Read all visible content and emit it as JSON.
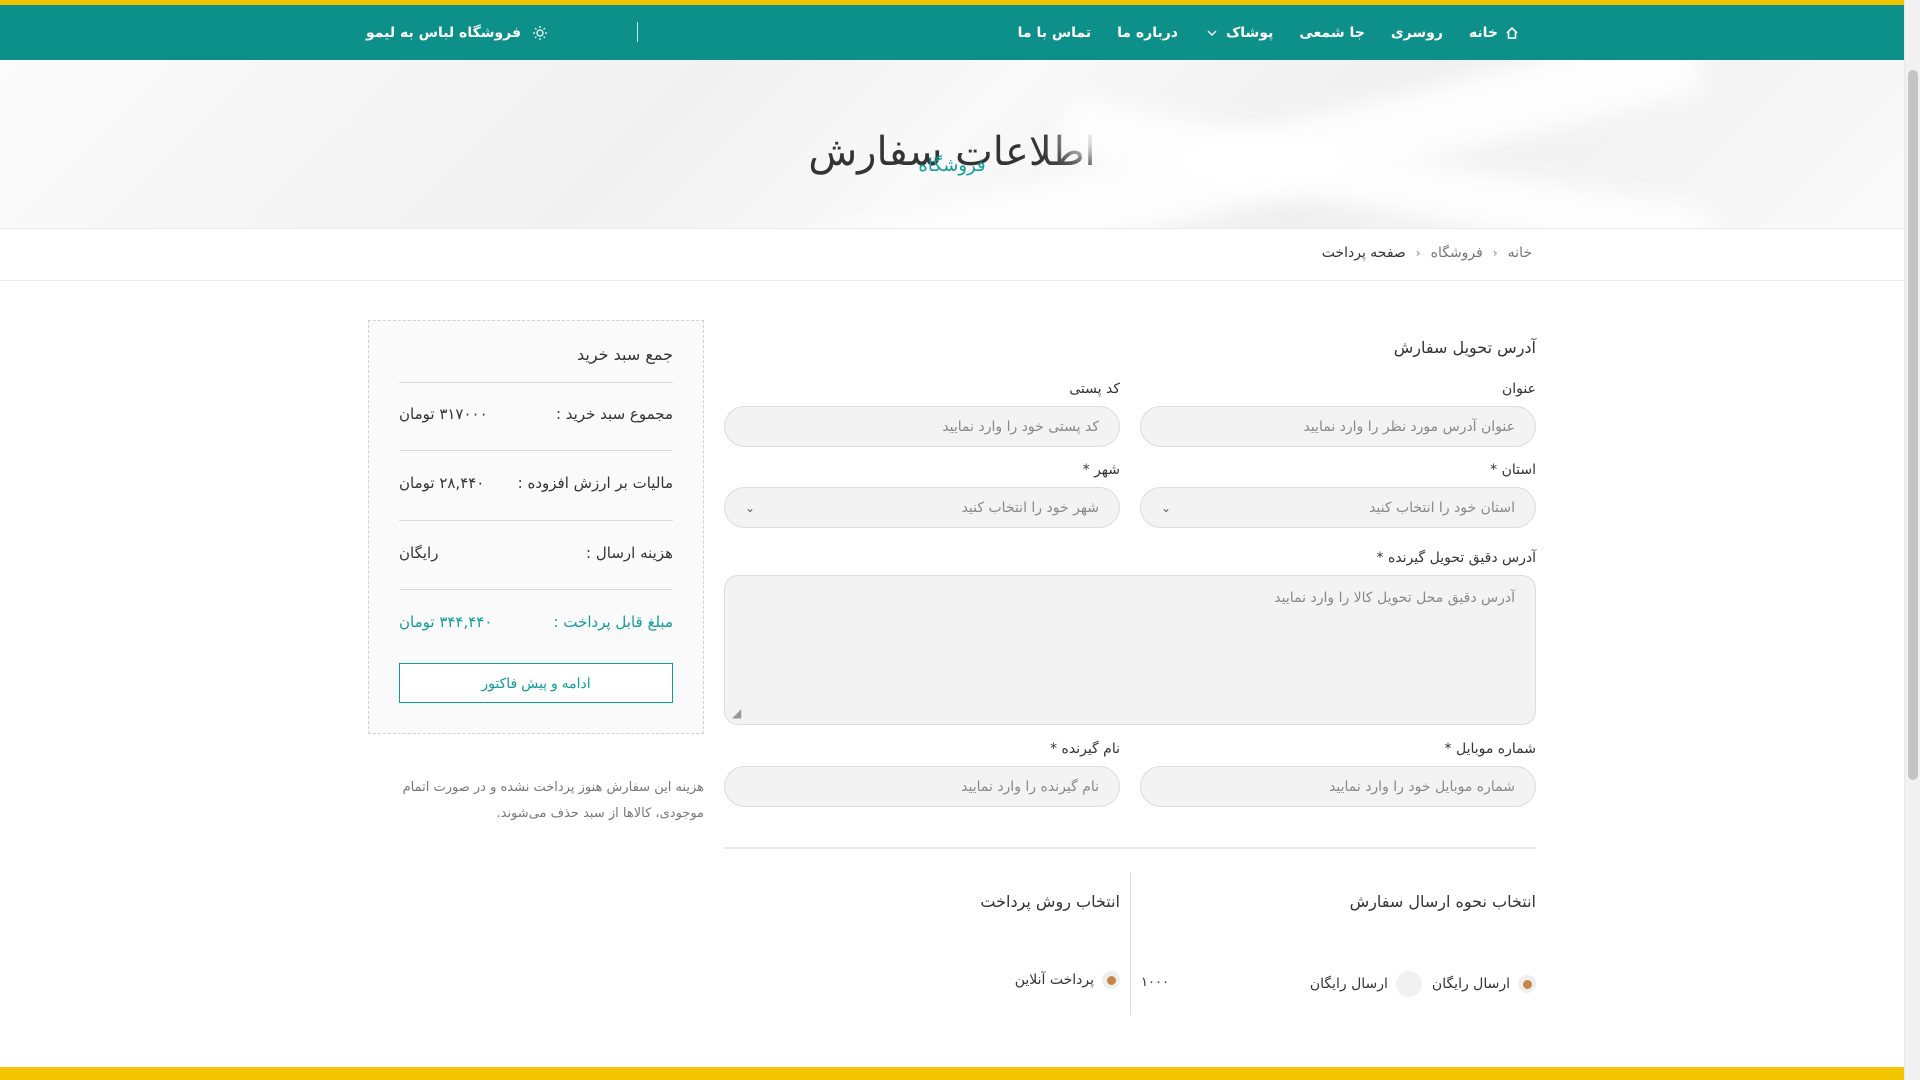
{
  "nav": {
    "items": [
      {
        "label": "خانه",
        "icon": "home-icon"
      },
      {
        "label": "روسری"
      },
      {
        "label": "جا شمعی"
      },
      {
        "label": "پوشاک",
        "dropdown": true
      },
      {
        "label": "درباره ما"
      },
      {
        "label": "تماس با ما"
      }
    ],
    "brand": "فروشگاه لباس به لیمو",
    "brand_icon": "sun-icon"
  },
  "hero": {
    "title": "اطلاعات سفارش",
    "subtitle": "فروشگاه"
  },
  "breadcrumb": [
    "خانه",
    "فروشگاه",
    "صفحه پرداخت"
  ],
  "form": {
    "address_title": "آدرس تحویل سفارش",
    "title_label": "عنوان",
    "title_placeholder": "عنوان آدرس مورد نظر را وارد نمایید",
    "postal_label": "کد پستی",
    "postal_placeholder": "کد پستی خود را وارد نمایید",
    "province_label": "استان *",
    "province_value": "استان خود را انتخاب کنید",
    "city_label": "شهر *",
    "city_value": "شهر خود را انتخاب کنید",
    "address_label": "آدرس دقیق تحویل گیرنده *",
    "address_placeholder": "آدرس دقیق محل تحویل کالا را وارد نمایید",
    "mobile_label": "شماره موبایل *",
    "mobile_placeholder": "شماره موبایل خود را وارد نمایید",
    "receiver_label": "نام گیرنده *",
    "receiver_placeholder": "نام گیرنده را وارد نمایید",
    "shipping_title": "انتخاب نحوه ارسال سفارش",
    "payment_title": "انتخاب روش پرداخت",
    "shipping_option_selected": "ارسال رایگان",
    "shipping_option_plain": "ارسال رایگان",
    "shipping_price": "۱۰۰۰",
    "payment_option": "پرداخت آنلاین"
  },
  "summary": {
    "title": "جمع سبد خرید",
    "cart_total_label": "مجموع سبد خرید :",
    "cart_total_value": "۳۱۷۰۰۰ تومان",
    "tax_label": "مالیات بر ارزش افزوده :",
    "tax_value": "۲۸,۴۴۰ تومان",
    "shipping_label": "هزینه ارسال :",
    "shipping_value": "رایگان",
    "payable_label": "مبلغ قابل پرداخت :",
    "payable_value": "۳۴۴,۴۴۰ تومان",
    "button_label": "ادامه و پیش فاکتور",
    "note": "هزینه این سفارش هنوز پرداخت نشده و در صورت اتمام موجودی، کالاها از سبد حذف می‌شوند."
  },
  "colors": {
    "teal": "#0d8f8a",
    "gold": "#f3c400",
    "radio": "#c6864a"
  }
}
